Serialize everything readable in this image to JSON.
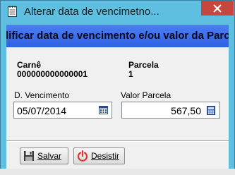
{
  "window": {
    "title": "Alterar data de vencimetno...",
    "close_icon": "close-icon"
  },
  "banner": {
    "text": "dificar data de vencimento e/ou valor da Parcela"
  },
  "info": {
    "carne_label": "Carnê",
    "carne_value": "000000000000001",
    "parcela_label": "Parcela",
    "parcela_value": "1"
  },
  "form": {
    "vencimento_label": "D. Vencimento",
    "vencimento_value": "05/07/2014",
    "valor_label": "Valor Parcela",
    "valor_value": "567,50"
  },
  "buttons": {
    "salvar": "Salvar",
    "desistir": "Desistir"
  },
  "colors": {
    "titlebar": "#5fbfe1",
    "banner": "#2f62e5",
    "close": "#c7463f"
  }
}
